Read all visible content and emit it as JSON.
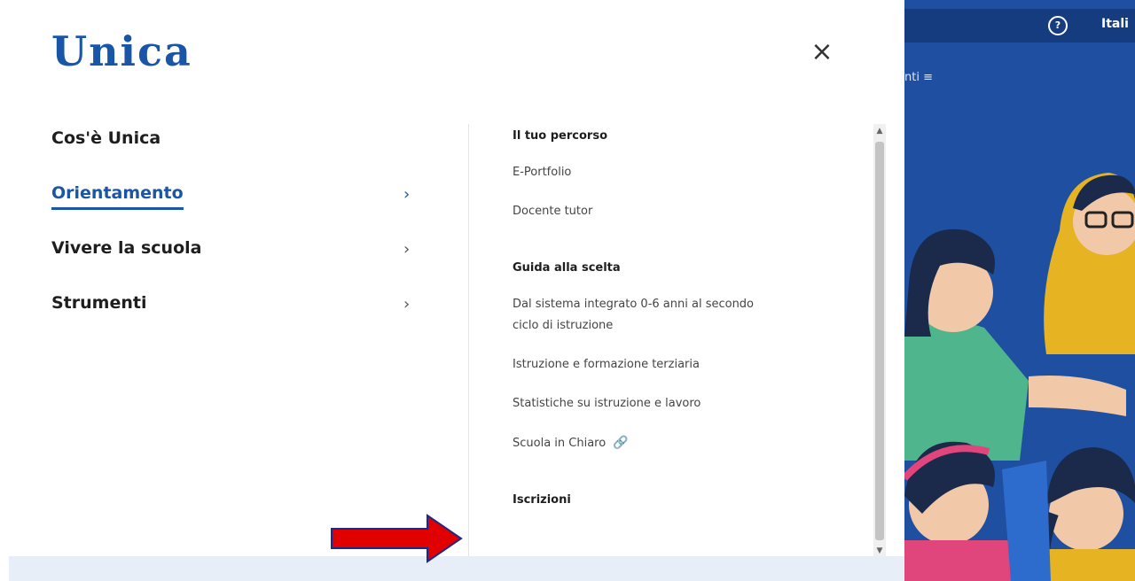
{
  "logo": {
    "text": "Unica"
  },
  "close_icon_glyph": "×",
  "main_nav": [
    {
      "label": "Cos'è Unica",
      "chevron": ""
    },
    {
      "label": "Orientamento",
      "chevron": "›"
    },
    {
      "label": "Vivere la scuola",
      "chevron": "›"
    },
    {
      "label": "Strumenti",
      "chevron": "›"
    }
  ],
  "submenu": {
    "section1": {
      "heading": "Il tuo percorso",
      "links": [
        "E-Portfolio",
        "Docente tutor"
      ]
    },
    "section2": {
      "heading": "Guida alla scelta",
      "links": [
        "Dal sistema integrato 0-6 anni al secondo ciclo di istruzione",
        "Istruzione e formazione terziaria",
        "Statistiche su istruzione e lavoro",
        "Scuola in Chiaro"
      ],
      "external_link_icon": "🔗"
    },
    "section3": {
      "heading": "Iscrizioni"
    }
  },
  "site": {
    "lang_text": "Itali",
    "help_icon_glyph": "?",
    "nav_fragment": "nti ≡"
  },
  "colors": {
    "brand_blue": "#1a56a8",
    "site_blue": "#1f4fa0",
    "arrow_red": "#e00000"
  }
}
